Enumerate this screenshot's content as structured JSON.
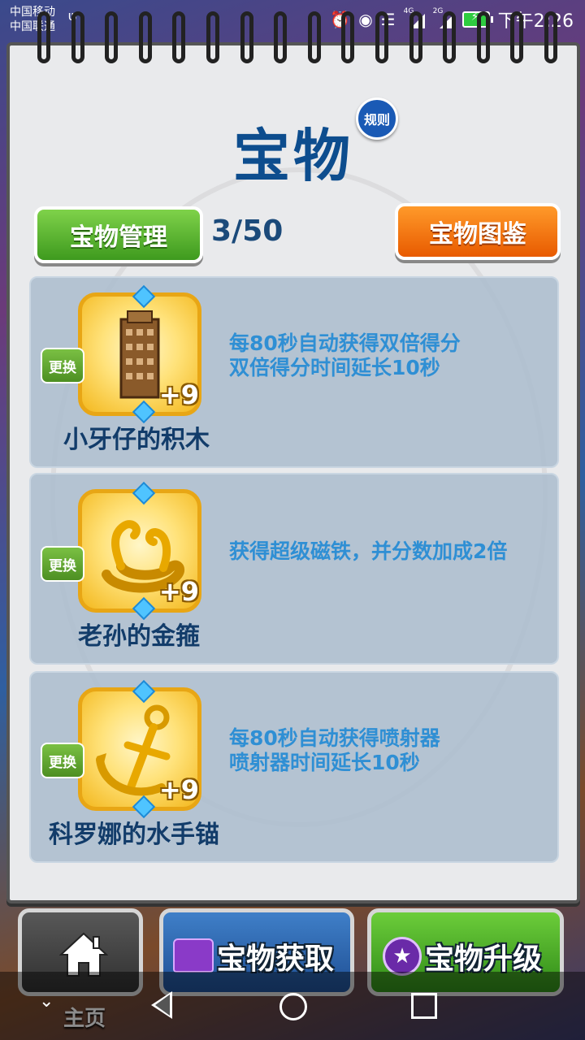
{
  "status_bar": {
    "carrier_1": "中国移动",
    "carrier_2": "中国联通",
    "net_1": "4G",
    "net_2": "2G",
    "time": "下午2:26",
    "icons": [
      "usb-icon",
      "alarm-icon",
      "eye-icon",
      "wifi-icon",
      "signal-icon",
      "signal-icon",
      "battery-icon"
    ]
  },
  "header": {
    "title": "宝物",
    "rules_label": "规则"
  },
  "toolbar": {
    "manage_label": "宝物管理",
    "count": "3/50",
    "gallery_label": "宝物图鉴"
  },
  "treasures": [
    {
      "name": "小牙仔的积木",
      "level": "+9",
      "change_label": "更换",
      "desc_line1": "每80秒自动获得双倍得分",
      "desc_line2": "双倍得分时间延长10秒",
      "icon": "building-blocks-icon"
    },
    {
      "name": "老孙的金箍",
      "level": "+9",
      "change_label": "更换",
      "desc_line1": "获得超级磁铁，并分数加成2倍",
      "desc_line2": "",
      "icon": "golden-headband-icon"
    },
    {
      "name": "科罗娜的水手锚",
      "level": "+9",
      "change_label": "更换",
      "desc_line1": "每80秒自动获得喷射器",
      "desc_line2": "喷射器时间延长10秒",
      "icon": "anchor-icon"
    }
  ],
  "bottom_bar": {
    "home_label": "主页",
    "obtain_label": "宝物获取",
    "upgrade_label": "宝物升级"
  },
  "colors": {
    "title_blue": "#0d4d8e",
    "green_button": "#3e9a1e",
    "orange_button": "#e85a00",
    "desc_blue": "#2f8fd4"
  }
}
